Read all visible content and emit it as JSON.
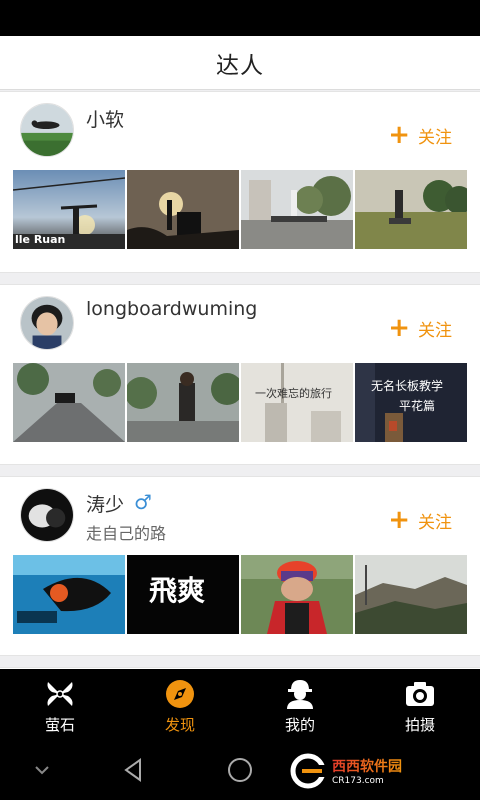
{
  "header": {
    "title": "达人"
  },
  "users": [
    {
      "name": "小软",
      "follow_label": "关注",
      "thumb_caption": "lle Ruan"
    },
    {
      "name": "longboardwuming",
      "follow_label": "关注",
      "thumb_text_1": "一次难忘的旅行",
      "thumb_text_2": "无名长板教学",
      "thumb_text_3": "平花篇"
    },
    {
      "name": "涛少",
      "gender_symbol": "♂",
      "signature": "走自己的路",
      "follow_label": "关注",
      "thumb_calligraphy": "飛爽"
    }
  ],
  "tabs": [
    {
      "label": "萤石",
      "icon": "pinwheel-icon",
      "active": false
    },
    {
      "label": "发现",
      "icon": "compass-icon",
      "active": true
    },
    {
      "label": "我的",
      "icon": "user-icon",
      "active": false
    },
    {
      "label": "拍摄",
      "icon": "camera-icon",
      "active": false
    }
  ],
  "system_nav": [
    "back-icon",
    "home-icon",
    "recent-apps-icon"
  ],
  "watermark": {
    "text": "西西软件园",
    "url": "CR173.com"
  },
  "colors": {
    "accent": "#f0930f",
    "male": "#3b8fd6",
    "bar": "#000000"
  }
}
